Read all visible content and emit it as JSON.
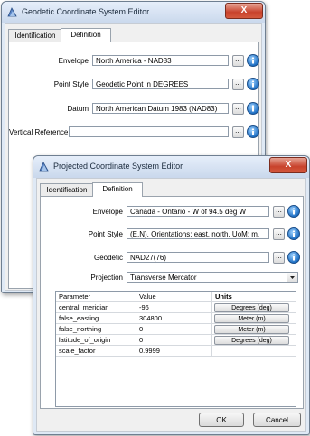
{
  "geo_window": {
    "title": "Geodetic Coordinate System Editor",
    "close_label": "X",
    "tabs": [
      {
        "label": "Identification"
      },
      {
        "label": "Definition"
      }
    ],
    "active_tab": "Definition",
    "fields": [
      {
        "label": "Envelope",
        "value": "North America - NAD83"
      },
      {
        "label": "Point Style",
        "value": "Geodetic Point in DEGREES"
      },
      {
        "label": "Datum",
        "value": "North American Datum 1983 (NAD83)"
      },
      {
        "label": "Vertical Reference",
        "value": ""
      }
    ],
    "dots_label": "..."
  },
  "proj_window": {
    "title": "Projected Coordinate System Editor",
    "close_label": "X",
    "tabs": [
      {
        "label": "Identification"
      },
      {
        "label": "Definition"
      }
    ],
    "active_tab": "Definition",
    "fields": [
      {
        "label": "Envelope",
        "value": "Canada - Ontario - W of 94.5 deg W"
      },
      {
        "label": "Point Style",
        "value": "(E,N). Orientations: east, north.  UoM: m."
      },
      {
        "label": "Geodetic",
        "value": "NAD27(76)"
      }
    ],
    "projection": {
      "label": "Projection",
      "value": "Transverse Mercator"
    },
    "dots_label": "...",
    "table": {
      "headers": [
        "Parameter",
        "Value",
        "Units"
      ],
      "rows": [
        {
          "parameter": "central_meridian",
          "value": "-96",
          "units": "Degrees (deg)"
        },
        {
          "parameter": "false_easting",
          "value": "304800",
          "units": "Meter (m)"
        },
        {
          "parameter": "false_northing",
          "value": "0",
          "units": "Meter (m)"
        },
        {
          "parameter": "latitude_of_origin",
          "value": "0",
          "units": "Degrees (deg)"
        },
        {
          "parameter": "scale_factor",
          "value": "0.9999",
          "units": ""
        }
      ]
    },
    "ok_label": "OK",
    "cancel_label": "Cancel"
  }
}
